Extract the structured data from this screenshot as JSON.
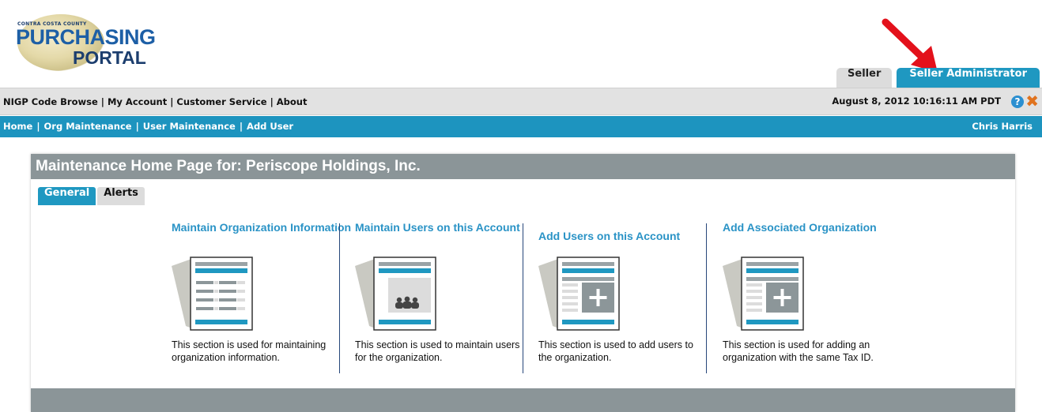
{
  "logo": {
    "small": "CONTRA COSTA COUNTY",
    "line1": "PURCHASING",
    "line2": "PORTAL"
  },
  "role_tabs": [
    {
      "label": "Seller"
    },
    {
      "label": "Seller Administrator"
    }
  ],
  "topbar": {
    "links": [
      "NIGP Code Browse",
      "My Account",
      "Customer Service",
      "About"
    ],
    "separator": "|",
    "datetime": "August 8, 2012 10:16:11 AM PDT",
    "help_symbol": "?",
    "close_symbol": "✖"
  },
  "bluenav": {
    "links": [
      "Home",
      "Org Maintenance",
      "User Maintenance",
      "Add User"
    ],
    "separator": "|",
    "user": "Chris Harris"
  },
  "panel": {
    "title": "Maintenance Home Page for: Periscope Holdings, Inc.",
    "tabs": [
      "General",
      "Alerts"
    ],
    "cards": [
      {
        "title": "Maintain Organization Information",
        "desc": "This section is used for maintaining organization information.",
        "icon": "document-list-icon"
      },
      {
        "title": "Maintain Users on this Account",
        "desc": "This section is used to maintain users for the organization.",
        "icon": "users-document-icon"
      },
      {
        "title": "Add Users on this Account",
        "desc": "This section is used to add users to the organization.",
        "icon": "add-document-icon"
      },
      {
        "title": "Add Associated Organization",
        "desc": "This section is used for adding an organization with the same Tax ID.",
        "icon": "add-document-icon"
      }
    ]
  },
  "colors": {
    "accent": "#1f98c1",
    "header_gray": "#8b9598",
    "link_blue": "#2a93c6",
    "arrow_red": "#e3111b"
  }
}
